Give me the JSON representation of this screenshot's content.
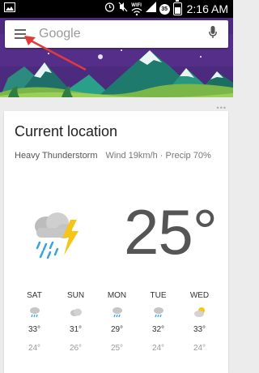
{
  "status_bar": {
    "time": "2:16 AM",
    "battery_badge": "35",
    "network_label": "WIFI"
  },
  "search": {
    "placeholder": "Google"
  },
  "weather": {
    "title": "Current location",
    "condition": "Heavy Thunderstorm",
    "wind": "Wind 19km/h",
    "precip": "Precip 70%",
    "temperature": "25°",
    "forecast": [
      {
        "day": "SAT",
        "high": "33°",
        "low": "24°",
        "icon": "rain-icon"
      },
      {
        "day": "SUN",
        "high": "31°",
        "low": "26°",
        "icon": "cloud-icon"
      },
      {
        "day": "MON",
        "high": "29°",
        "low": "25°",
        "icon": "rain-icon"
      },
      {
        "day": "TUE",
        "high": "32°",
        "low": "24°",
        "icon": "rain-icon"
      },
      {
        "day": "WED",
        "high": "33°",
        "low": "24°",
        "icon": "partly-cloudy-icon"
      }
    ]
  },
  "colors": {
    "banner_sky": "#4c2a7e",
    "grass": "#7ab648",
    "rain_blue": "#39a4d8",
    "lightning_yellow": "#f5c518"
  }
}
